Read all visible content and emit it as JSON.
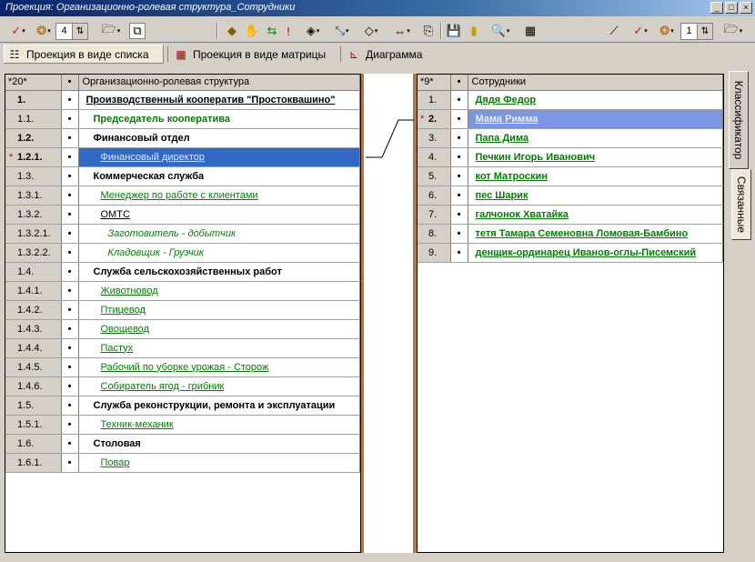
{
  "window": {
    "title": "Проекция: Организационно-ролевая структура_Сотрудники"
  },
  "toolbar": {
    "level_left": "4",
    "level_right": "1"
  },
  "tabs": [
    {
      "label": "Проекция в виде списка"
    },
    {
      "label": "Проекция в виде матрицы"
    },
    {
      "label": "Диаграмма"
    }
  ],
  "left_grid": {
    "count_header": "*20*",
    "dot_header": "•",
    "name_header": "Организационно-ролевая структура",
    "rows": [
      {
        "num": "1.",
        "dot": "•",
        "name": "Производственный кооператив \"Простоквашино\"",
        "style": "t-b t-u",
        "indent": 0,
        "bold_num": true
      },
      {
        "num": "1.1.",
        "dot": "•",
        "name": "Председатель кооператива",
        "style": "t-gb",
        "indent": 8
      },
      {
        "num": "1.2.",
        "dot": "•",
        "name": "Финансовый отдел",
        "style": "t-b",
        "indent": 8,
        "bold_num": true
      },
      {
        "num": "1.2.1.",
        "dot": "•",
        "name": "Финансовый директор",
        "style": "t-g t-u",
        "indent": 16,
        "bold_num": true,
        "marked": true,
        "selected": true
      },
      {
        "num": "1.3.",
        "dot": "•",
        "name": "Коммерческая служба",
        "style": "t-b",
        "indent": 8
      },
      {
        "num": "1.3.1.",
        "dot": "•",
        "name": "Менеджер по работе с клиентами",
        "style": "t-g t-u",
        "indent": 16
      },
      {
        "num": "1.3.2.",
        "dot": "•",
        "name": "ОМТС",
        "style": "t-u",
        "indent": 16
      },
      {
        "num": "1.3.2.1.",
        "dot": "•",
        "name": "Заготовитель - добытчик",
        "style": "t-gi",
        "indent": 24
      },
      {
        "num": "1.3.2.2.",
        "dot": "•",
        "name": "Кладовщик - Грузчик",
        "style": "t-gi",
        "indent": 24
      },
      {
        "num": "1.4.",
        "dot": "•",
        "name": "Служба сельскохозяйственных работ",
        "style": "t-b",
        "indent": 8
      },
      {
        "num": "1.4.1.",
        "dot": "•",
        "name": "Животновод",
        "style": "t-g t-u",
        "indent": 16
      },
      {
        "num": "1.4.2.",
        "dot": "•",
        "name": "Птицевод",
        "style": "t-g t-u",
        "indent": 16
      },
      {
        "num": "1.4.3.",
        "dot": "•",
        "name": "Овощевод",
        "style": "t-g t-u",
        "indent": 16
      },
      {
        "num": "1.4.4.",
        "dot": "•",
        "name": "Пастух",
        "style": "t-g t-u",
        "indent": 16
      },
      {
        "num": "1.4.5.",
        "dot": "•",
        "name": "Рабочий по уборке урожая - Сторож",
        "style": "t-g t-u",
        "indent": 16
      },
      {
        "num": "1.4.6.",
        "dot": "•",
        "name": "Собиратель ягод - грибник",
        "style": "t-g t-u",
        "indent": 16
      },
      {
        "num": "1.5.",
        "dot": "•",
        "name": "Служба реконструкции, ремонта и эксплуатации",
        "style": "t-b",
        "indent": 8
      },
      {
        "num": "1.5.1.",
        "dot": "•",
        "name": "Техник-механик",
        "style": "t-g t-u",
        "indent": 16
      },
      {
        "num": "1.6.",
        "dot": "•",
        "name": "Столовая",
        "style": "t-b",
        "indent": 8
      },
      {
        "num": "1.6.1.",
        "dot": "•",
        "name": "Повар",
        "style": "t-g t-u",
        "indent": 16
      }
    ]
  },
  "right_grid": {
    "count_header": "*9*",
    "dot_header": "•",
    "name_header": "Сотрудники",
    "rows": [
      {
        "num": "1.",
        "dot": "•",
        "name": "Дядя Федор"
      },
      {
        "num": "2.",
        "dot": "•",
        "name": "Мама Римма",
        "marked": true,
        "selected": true
      },
      {
        "num": "3.",
        "dot": "•",
        "name": "Папа Дима"
      },
      {
        "num": "4.",
        "dot": "•",
        "name": "Печкин Игорь Иванович"
      },
      {
        "num": "5.",
        "dot": "•",
        "name": "кот Матроскин"
      },
      {
        "num": "6.",
        "dot": "•",
        "name": "пес Шарик"
      },
      {
        "num": "7.",
        "dot": "•",
        "name": "галчонок Хватайка"
      },
      {
        "num": "8.",
        "dot": "•",
        "name": "тетя Тамара Семеновна Ломовая-Бамбино"
      },
      {
        "num": "9.",
        "dot": "•",
        "name": "денщик-ординарец Иванов-оглы-Писемский"
      }
    ]
  },
  "side_tabs": {
    "classifier": "Классификатор",
    "related": "Связанные"
  },
  "colors": {
    "selection": "#3169c6",
    "selection_secondary": "#7b95e0",
    "green_text": "#008000",
    "splitter": "#d07020"
  }
}
